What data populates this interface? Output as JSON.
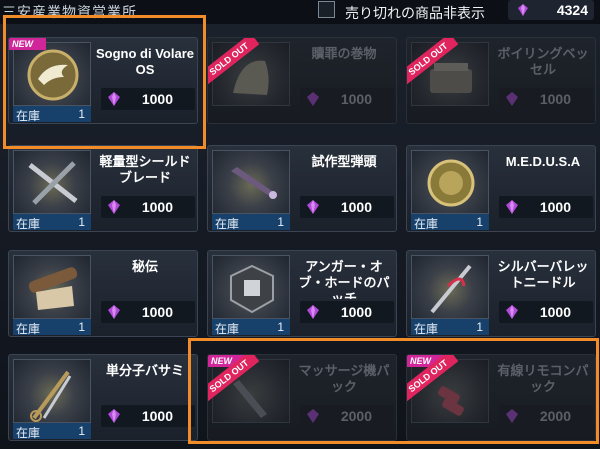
{
  "header": {
    "shop_title": "三安産業物資営業所",
    "filter_label": "売り切れの商品非表示",
    "currency_icon": "purple-gem-icon",
    "currency_value": "4324"
  },
  "labels": {
    "stock": "在庫",
    "new_badge": "NEW",
    "sold_out": "SOLD OUT"
  },
  "items": [
    {
      "name": "Sogno di Volare OS",
      "price": "1000",
      "stock": "1",
      "new": true,
      "sold_out": false
    },
    {
      "name": "贖罪の巻物",
      "price": "1000",
      "stock": "",
      "new": false,
      "sold_out": true
    },
    {
      "name": "ボイリングベッセル",
      "price": "1000",
      "stock": "",
      "new": false,
      "sold_out": true
    },
    {
      "name": "軽量型シールドブレード",
      "price": "1000",
      "stock": "1",
      "new": false,
      "sold_out": false
    },
    {
      "name": "試作型弾頭",
      "price": "1000",
      "stock": "1",
      "new": false,
      "sold_out": false
    },
    {
      "name": "M.E.D.U.S.A",
      "price": "1000",
      "stock": "1",
      "new": false,
      "sold_out": false
    },
    {
      "name": "秘伝",
      "price": "1000",
      "stock": "1",
      "new": false,
      "sold_out": false
    },
    {
      "name": "アンガー・オブ・ホードのパッチ",
      "price": "1000",
      "stock": "1",
      "new": false,
      "sold_out": false
    },
    {
      "name": "シルバーバレットニードル",
      "price": "1000",
      "stock": "1",
      "new": false,
      "sold_out": false
    },
    {
      "name": "単分子バサミ",
      "price": "1000",
      "stock": "1",
      "new": false,
      "sold_out": false
    },
    {
      "name": "マッサージ機パック",
      "price": "2000",
      "stock": "",
      "new": true,
      "sold_out": true
    },
    {
      "name": "有線リモコンパック",
      "price": "2000",
      "stock": "",
      "new": true,
      "sold_out": true
    }
  ],
  "colors": {
    "highlight": "#f28c28",
    "stock_bar": "#17406a",
    "new_badge": "#d0269a",
    "soldout_ribbon": "#e0245e",
    "gem": "#b04ad8"
  }
}
